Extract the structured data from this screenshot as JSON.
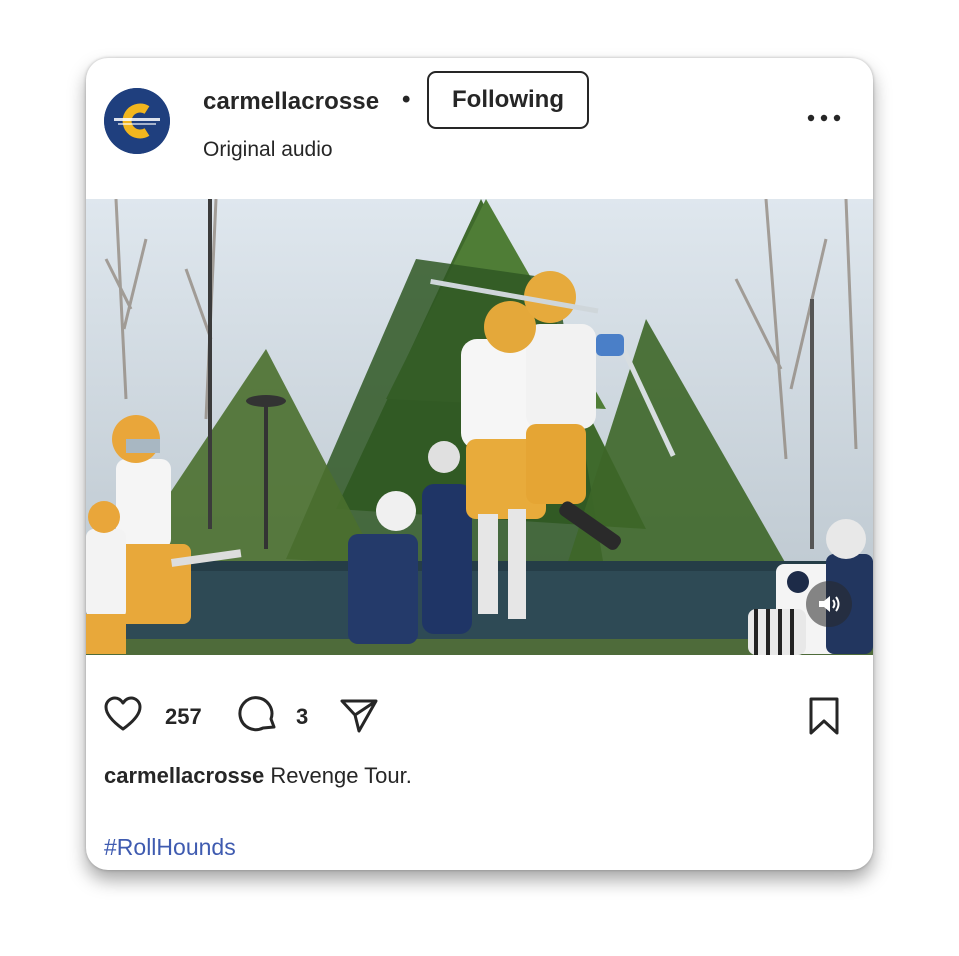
{
  "post": {
    "username": "carmellacrosse",
    "separator": "•",
    "follow_label": "Following",
    "subtitle": "Original audio",
    "more_icon": "more-horizontal-icon",
    "likes": "257",
    "comments": "3",
    "caption_user": "carmellacrosse",
    "caption_text": "Revenge Tour.",
    "hashtag": "#RollHounds",
    "accent_color": "#3f5bb0",
    "avatar_colors": {
      "background": "#1f3f7e",
      "letter": "#f2b61e"
    },
    "icons": {
      "like": "heart-icon",
      "comment": "comment-bubble-icon",
      "share": "paper-plane-icon",
      "save": "bookmark-icon",
      "mute": "speaker-icon"
    }
  }
}
